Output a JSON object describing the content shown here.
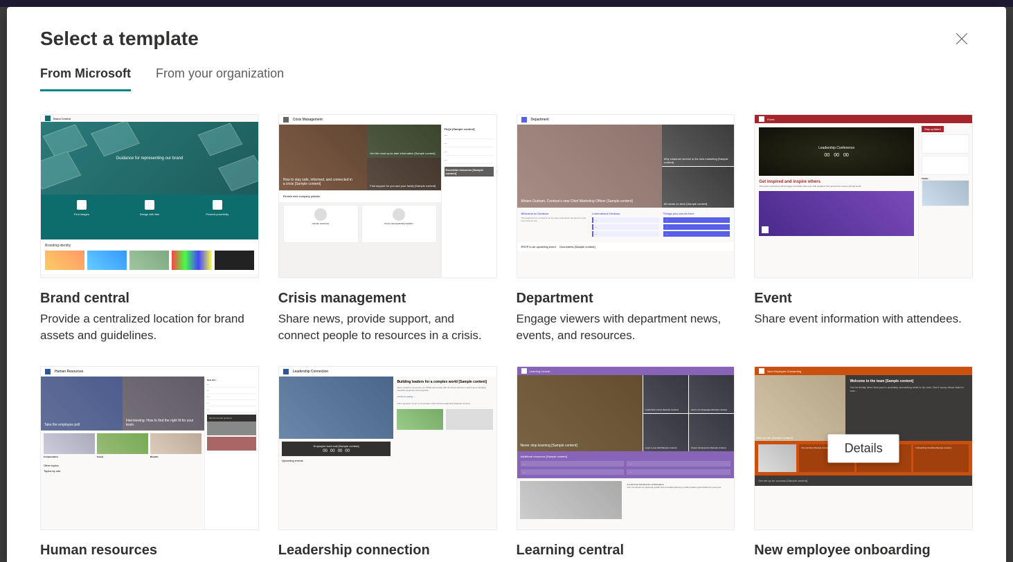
{
  "modal": {
    "title": "Select a template",
    "close_label": "Close"
  },
  "tabs": {
    "microsoft": "From Microsoft",
    "organization": "From your organization"
  },
  "details_button": "Details",
  "templates": [
    {
      "id": "brand-central",
      "title": "Brand central",
      "desc": "Provide a centralized location for brand assets and guidelines."
    },
    {
      "id": "crisis-management",
      "title": "Crisis management",
      "desc": "Share news, provide support, and connect people to resources in a crisis."
    },
    {
      "id": "department",
      "title": "Department",
      "desc": "Engage viewers with department news, events, and resources."
    },
    {
      "id": "event",
      "title": "Event",
      "desc": "Share event information with attendees."
    },
    {
      "id": "human-resources",
      "title": "Human resources",
      "desc": ""
    },
    {
      "id": "leadership-connection",
      "title": "Leadership connection",
      "desc": ""
    },
    {
      "id": "learning-central",
      "title": "Learning central",
      "desc": ""
    },
    {
      "id": "new-employee-onboarding",
      "title": "New employee onboarding",
      "desc": ""
    }
  ],
  "thumb_text": {
    "brand_central": {
      "site": "Brand Central",
      "hero": "Guidance for representing our brand",
      "cols": [
        "Find images",
        "Design with flair",
        "Present powerfully"
      ],
      "section": "Branding identity"
    },
    "crisis": {
      "site": "Crisis Management",
      "hero": "How to stay safe, informed, and connected in a crisis [Sample content]",
      "r1": "Get the most up-to-date information [Sample content]",
      "r2": "Find support for you and your family [Sample content]",
      "news": "Review new company policies",
      "side_title": "FAQs [Sample content]",
      "side_title2": "Essential resources [Sample content]"
    },
    "department": {
      "site": "Department",
      "hero": "Miriam Graham, Contoso's new Chief Marketing Officer [Sample content]",
      "r1": "Why customer service is the new marketing [Sample content]",
      "r2": "All hands on deck [Sample content]",
      "welcome": "Welcome to Contoso",
      "learn": "Learn about Contoso",
      "things": "Things you can do here",
      "rsvp": "RSVP to an upcoming event",
      "docs": "Documents [Sample content]"
    },
    "event": {
      "site": "Event",
      "hero": "Leadership Conference",
      "count": [
        "00",
        "00",
        "00"
      ],
      "stay": "Stay updated",
      "red": "Get inspired and inspire others",
      "side": "Twitter"
    },
    "hr": {
      "site": "Human Resources",
      "l": "Take the employee poll",
      "r": "Interviewing: How to find the right fit for your team",
      "side_title": "How do I...",
      "cards": [
        "Compensation",
        "Career",
        "Benefits"
      ],
      "other": "Other topics",
      "roles": "Topics by role"
    },
    "leadership": {
      "site": "Leadership Connection",
      "h": "Building leaders for a complex world [Sample content]",
      "box": "Employee town hall [Sample content]",
      "count": [
        "00",
        "00",
        "00",
        "00"
      ],
      "ask": "Ask a question or join a conversation with Contoso leadership [Sample content]",
      "upcoming": "Upcoming events"
    },
    "learning": {
      "site": "Learning Central",
      "hero": "Never stop learning [Sample content]",
      "tiles": [
        "Leadership course [Sample content]",
        "Learn new languages [Sample content]",
        "Learn a new skill [Sample content]",
        "Career development [Sample content]"
      ],
      "add": "Additional resources [Sample content]",
      "note": "A note from the Director of Education"
    },
    "onboarding": {
      "site": "New Employee Onboarding",
      "hero": "Welcome to the team [Sample content]",
      "who": "Who we are [Sample content]",
      "cards": [
        "Our priorities [Sample content]",
        "Help & support [Sample content]",
        "Onboarding checklist [Sample content]"
      ],
      "setup": "Get set up for success [Sample content]"
    }
  }
}
